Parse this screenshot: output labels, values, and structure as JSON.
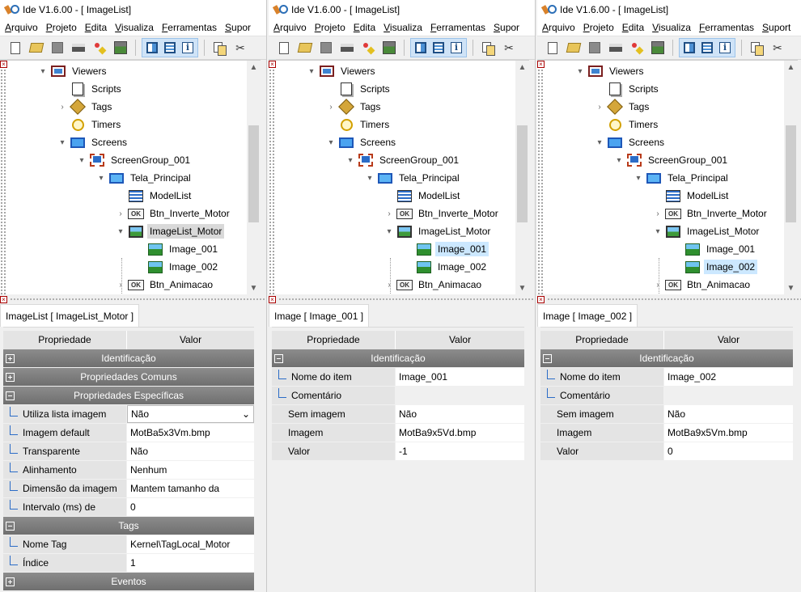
{
  "windows": [
    {
      "title": "Ide V1.6.00  - [ ImageList]",
      "menu": [
        "Arquivo",
        "Projeto",
        "Edita",
        "Visualiza",
        "Ferramentas",
        "Supor"
      ],
      "tree": [
        {
          "label": "Viewers",
          "icon": "viewers-icon",
          "twisty": "▾"
        },
        {
          "label": "Scripts",
          "icon": "scripts-icon",
          "twisty": ""
        },
        {
          "label": "Tags",
          "icon": "tags-icon",
          "twisty": "›"
        },
        {
          "label": "Timers",
          "icon": "timers-icon",
          "twisty": ""
        },
        {
          "label": "Screens",
          "icon": "screens-icon",
          "twisty": "▾"
        },
        {
          "label": "ScreenGroup_001",
          "icon": "screen-group-icon",
          "twisty": "▾"
        },
        {
          "label": "Tela_Principal",
          "icon": "screen-icon",
          "twisty": "▾"
        },
        {
          "label": "ModelList",
          "icon": "model-list-icon",
          "twisty": ""
        },
        {
          "label": "Btn_Inverte_Motor",
          "icon": "button-ok-icon",
          "twisty": "›"
        },
        {
          "label": "ImageList_Motor",
          "icon": "image-list-icon",
          "twisty": "▾"
        },
        {
          "label": "Image_001",
          "icon": "image-icon",
          "twisty": ""
        },
        {
          "label": "Image_002",
          "icon": "image-icon",
          "twisty": ""
        },
        {
          "label": "Btn_Animacao",
          "icon": "button-ok-icon",
          "twisty": "›"
        }
      ],
      "selected_index": 9,
      "panel_title": "ImageList [ ImageList_Motor ]",
      "grid_header": {
        "prop": "Propriedade",
        "value": "Valor"
      },
      "grid": [
        {
          "type": "cat",
          "label": "Identificação",
          "state": "plus"
        },
        {
          "type": "cat",
          "label": "Propriedades Comuns",
          "state": "plus"
        },
        {
          "type": "cat",
          "label": "Propriedades Específicas",
          "state": "minus"
        },
        {
          "type": "row",
          "key": "Utiliza lista imagem",
          "value": "Não",
          "sub": true,
          "combo": true
        },
        {
          "type": "row",
          "key": "Imagem default",
          "value": "MotBa5x3Vm.bmp",
          "sub": true
        },
        {
          "type": "row",
          "key": "Transparente",
          "value": "Não",
          "sub": true
        },
        {
          "type": "row",
          "key": "Alinhamento",
          "value": "Nenhum",
          "sub": true
        },
        {
          "type": "row",
          "key": "Dimensão da imagem",
          "value": "Mantem tamanho da",
          "sub": true
        },
        {
          "type": "row",
          "key": "Intervalo (ms) de",
          "value": "0",
          "sub": true
        },
        {
          "type": "cat",
          "label": "Tags",
          "state": "minus"
        },
        {
          "type": "row",
          "key": "Nome Tag",
          "value": "Kernel\\TagLocal_Motor",
          "sub": true
        },
        {
          "type": "row",
          "key": "Índice",
          "value": "1",
          "sub": true
        },
        {
          "type": "cat",
          "label": "Eventos",
          "state": "plus"
        }
      ]
    },
    {
      "title": "Ide V1.6.00  - [ ImageList]",
      "menu": [
        "Arquivo",
        "Projeto",
        "Edita",
        "Visualiza",
        "Ferramentas",
        "Supor"
      ],
      "tree": [
        {
          "label": "Viewers",
          "icon": "viewers-icon",
          "twisty": "▾"
        },
        {
          "label": "Scripts",
          "icon": "scripts-icon",
          "twisty": ""
        },
        {
          "label": "Tags",
          "icon": "tags-icon",
          "twisty": "›"
        },
        {
          "label": "Timers",
          "icon": "timers-icon",
          "twisty": ""
        },
        {
          "label": "Screens",
          "icon": "screens-icon",
          "twisty": "▾"
        },
        {
          "label": "ScreenGroup_001",
          "icon": "screen-group-icon",
          "twisty": "▾"
        },
        {
          "label": "Tela_Principal",
          "icon": "screen-icon",
          "twisty": "▾"
        },
        {
          "label": "ModelList",
          "icon": "model-list-icon",
          "twisty": ""
        },
        {
          "label": "Btn_Inverte_Motor",
          "icon": "button-ok-icon",
          "twisty": "›"
        },
        {
          "label": "ImageList_Motor",
          "icon": "image-list-icon",
          "twisty": "▾"
        },
        {
          "label": "Image_001",
          "icon": "image-icon",
          "twisty": ""
        },
        {
          "label": "Image_002",
          "icon": "image-icon",
          "twisty": ""
        },
        {
          "label": "Btn_Animacao",
          "icon": "button-ok-icon",
          "twisty": "›"
        }
      ],
      "selected_index": 10,
      "panel_title": "Image [ Image_001 ]",
      "grid_header": {
        "prop": "Propriedade",
        "value": "Valor"
      },
      "grid": [
        {
          "type": "cat",
          "label": "Identificação",
          "state": "minus"
        },
        {
          "type": "row",
          "key": "Nome do item",
          "value": "Image_001",
          "sub": true
        },
        {
          "type": "row",
          "key": "Comentário",
          "value": "",
          "sub": true,
          "blank": true
        },
        {
          "type": "row",
          "key": "Sem imagem",
          "value": "Não",
          "sub": false
        },
        {
          "type": "row",
          "key": "Imagem",
          "value": "MotBa9x5Vd.bmp",
          "sub": false
        },
        {
          "type": "row",
          "key": "Valor",
          "value": "-1",
          "sub": false
        }
      ]
    },
    {
      "title": "Ide V1.6.00  - [ ImageList]",
      "menu": [
        "Arquivo",
        "Projeto",
        "Edita",
        "Visualiza",
        "Ferramentas",
        "Suport"
      ],
      "tree": [
        {
          "label": "Viewers",
          "icon": "viewers-icon",
          "twisty": "▾"
        },
        {
          "label": "Scripts",
          "icon": "scripts-icon",
          "twisty": ""
        },
        {
          "label": "Tags",
          "icon": "tags-icon",
          "twisty": "›"
        },
        {
          "label": "Timers",
          "icon": "timers-icon",
          "twisty": ""
        },
        {
          "label": "Screens",
          "icon": "screens-icon",
          "twisty": "▾"
        },
        {
          "label": "ScreenGroup_001",
          "icon": "screen-group-icon",
          "twisty": "▾"
        },
        {
          "label": "Tela_Principal",
          "icon": "screen-icon",
          "twisty": "▾"
        },
        {
          "label": "ModelList",
          "icon": "model-list-icon",
          "twisty": ""
        },
        {
          "label": "Btn_Inverte_Motor",
          "icon": "button-ok-icon",
          "twisty": "›"
        },
        {
          "label": "ImageList_Motor",
          "icon": "image-list-icon",
          "twisty": "▾"
        },
        {
          "label": "Image_001",
          "icon": "image-icon",
          "twisty": ""
        },
        {
          "label": "Image_002",
          "icon": "image-icon",
          "twisty": ""
        },
        {
          "label": "Btn_Animacao",
          "icon": "button-ok-icon",
          "twisty": "›"
        }
      ],
      "selected_index": 11,
      "panel_title": "Image [ Image_002 ]",
      "grid_header": {
        "prop": "Propriedade",
        "value": "Valor"
      },
      "grid": [
        {
          "type": "cat",
          "label": "Identificação",
          "state": "minus"
        },
        {
          "type": "row",
          "key": "Nome do item",
          "value": "Image_002",
          "sub": true
        },
        {
          "type": "row",
          "key": "Comentário",
          "value": "",
          "sub": true,
          "blank": true
        },
        {
          "type": "row",
          "key": "Sem imagem",
          "value": "Não",
          "sub": false
        },
        {
          "type": "row",
          "key": "Imagem",
          "value": "MotBa9x5Vm.bmp",
          "sub": false
        },
        {
          "type": "row",
          "key": "Valor",
          "value": "0",
          "sub": false
        }
      ]
    }
  ],
  "toolbar_icons": [
    "new-file-icon",
    "open-folder-icon",
    "save-icon",
    "print-icon",
    "wizard-icon",
    "database-icon",
    "layout-split-icon",
    "layout-list-icon",
    "info-icon",
    "copy-icon",
    "cut-icon"
  ],
  "colors": {
    "selection": "#cce8ff",
    "category_bar": "#7a7a7a",
    "accent": "#2b6cc7"
  }
}
